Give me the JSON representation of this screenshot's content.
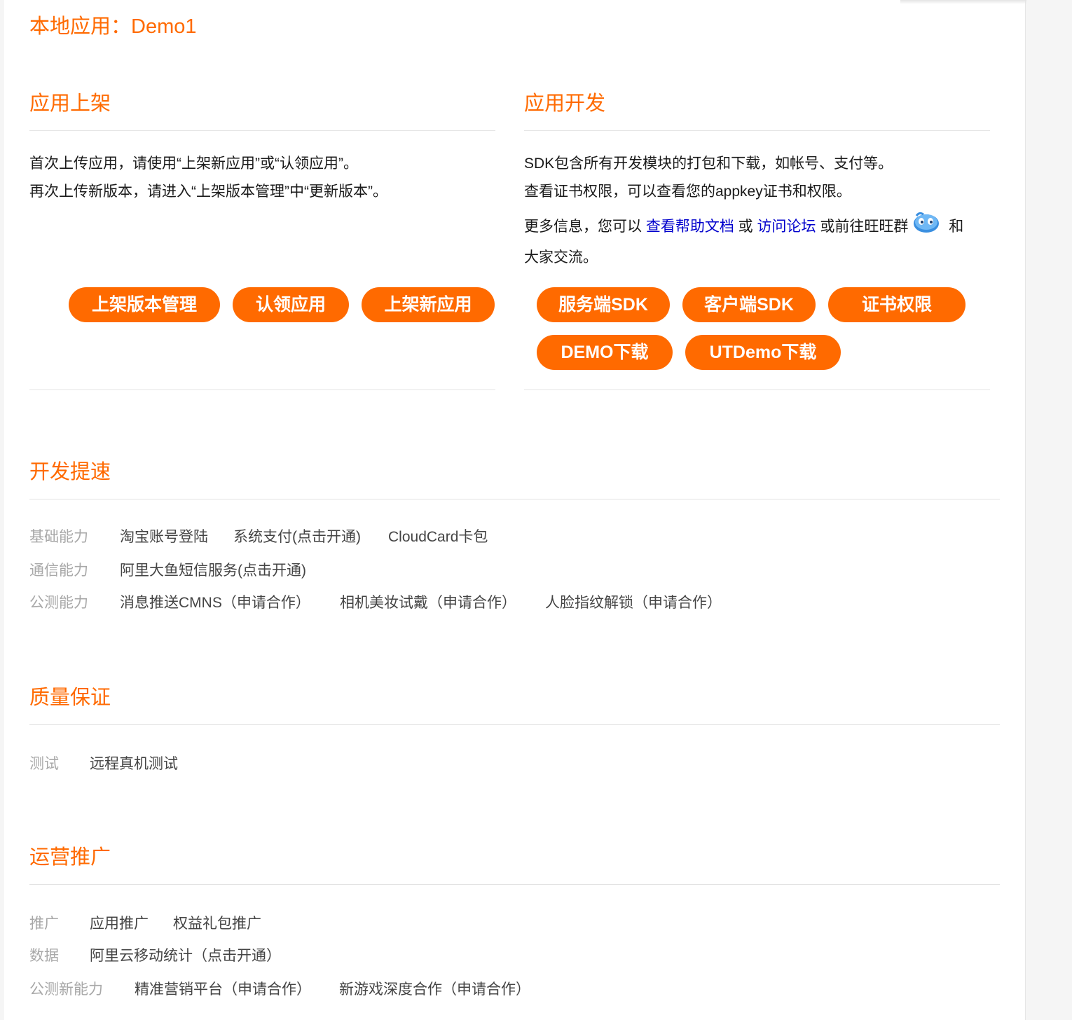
{
  "app_title": "本地应用：Demo1",
  "listing": {
    "title": "应用上架",
    "lines": [
      "首次上传应用，请使用“上架新应用”或“认领应用”。",
      "再次上传新版本，请进入“上架版本管理”中“更新版本”。"
    ],
    "buttons": [
      "上架版本管理",
      "认领应用",
      "上架新应用"
    ]
  },
  "develop": {
    "title": "应用开发",
    "line1": "SDK包含所有开发模块的打包和下载，如帐号、支付等。",
    "line2": "查看证书权限，可以查看您的appkey证书和权限。",
    "more_prefix": "更多信息，您可以 ",
    "help_link": "查看帮助文档",
    "or_text": " 或 ",
    "forum_link": "访问论坛",
    "wangwang_text": " 或前往旺旺群",
    "and_text": " 和",
    "line4": "大家交流。",
    "buttons": [
      "服务端SDK",
      "客户端SDK",
      "证书权限",
      "DEMO下载",
      "UTDemo下载"
    ]
  },
  "speedup": {
    "title": "开发提速",
    "rows": [
      {
        "label": "基础能力",
        "items": [
          "淘宝账号登陆",
          "系统支付(点击开通)",
          "CloudCard卡包"
        ]
      },
      {
        "label": "通信能力",
        "items": [
          "阿里大鱼短信服务(点击开通)"
        ]
      },
      {
        "label": "公测能力",
        "items": [
          "消息推送CMNS（申请合作）",
          "相机美妆试戴（申请合作）",
          "人脸指纹解锁（申请合作）"
        ]
      }
    ]
  },
  "quality": {
    "title": "质量保证",
    "rows": [
      {
        "label": "测试",
        "items": [
          "远程真机测试"
        ]
      }
    ]
  },
  "operations": {
    "title": "运营推广",
    "rows": [
      {
        "label": "推广",
        "items": [
          "应用推广",
          "权益礼包推广"
        ]
      },
      {
        "label": "数据",
        "items": [
          "阿里云移动统计（点击开通）"
        ]
      },
      {
        "label": "公测新能力",
        "items": [
          "精准营销平台（申请合作）",
          "新游戏深度合作（申请合作）"
        ]
      }
    ]
  },
  "colors": {
    "accent": "#ff6a00",
    "link": "#0000cc",
    "muted_label": "#a8a8a8"
  },
  "icons": {
    "wangwang": "wangwang-chat-icon"
  }
}
